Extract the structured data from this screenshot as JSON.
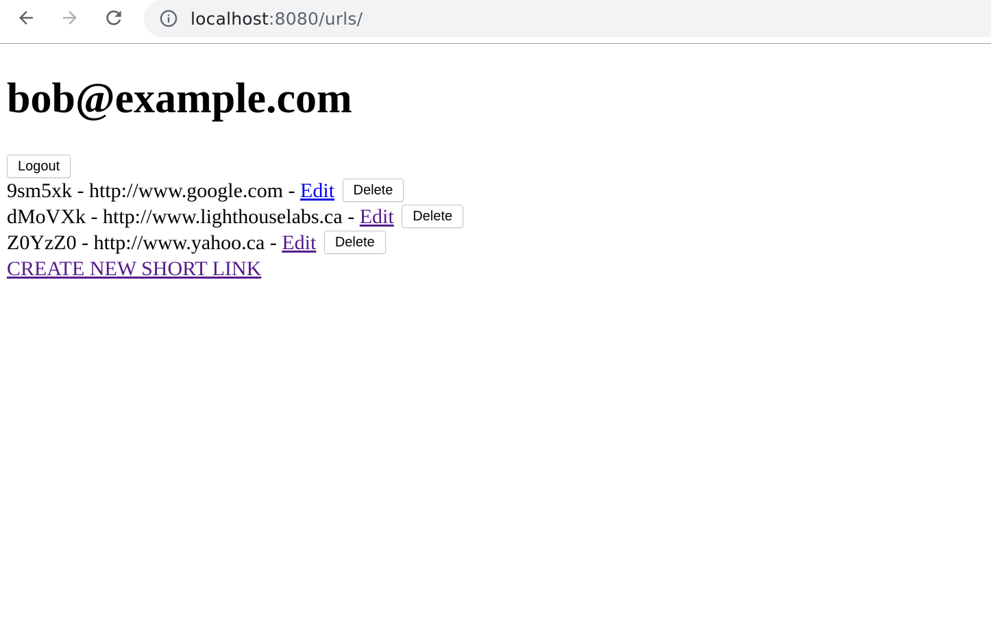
{
  "browser": {
    "url_host": "localhost",
    "url_rest": ":8080/urls/"
  },
  "page": {
    "user_email": "bob@example.com",
    "logout_label": "Logout",
    "separator": " - ",
    "edit_label": "Edit",
    "delete_label": "Delete",
    "urls": [
      {
        "short": "9sm5xk",
        "long": "http://www.google.com"
      },
      {
        "short": "dMoVXk",
        "long": "http://www.lighthouselabs.ca"
      },
      {
        "short": "Z0YzZ0",
        "long": "http://www.yahoo.ca"
      }
    ],
    "create_label": "CREATE NEW SHORT LINK"
  },
  "colors": {
    "link": "#0000ee",
    "visited_link": "#551a8b",
    "omnibox_bg": "#f1f3f4"
  },
  "icons": [
    "back-arrow-icon",
    "forward-arrow-icon",
    "reload-icon",
    "info-icon"
  ]
}
